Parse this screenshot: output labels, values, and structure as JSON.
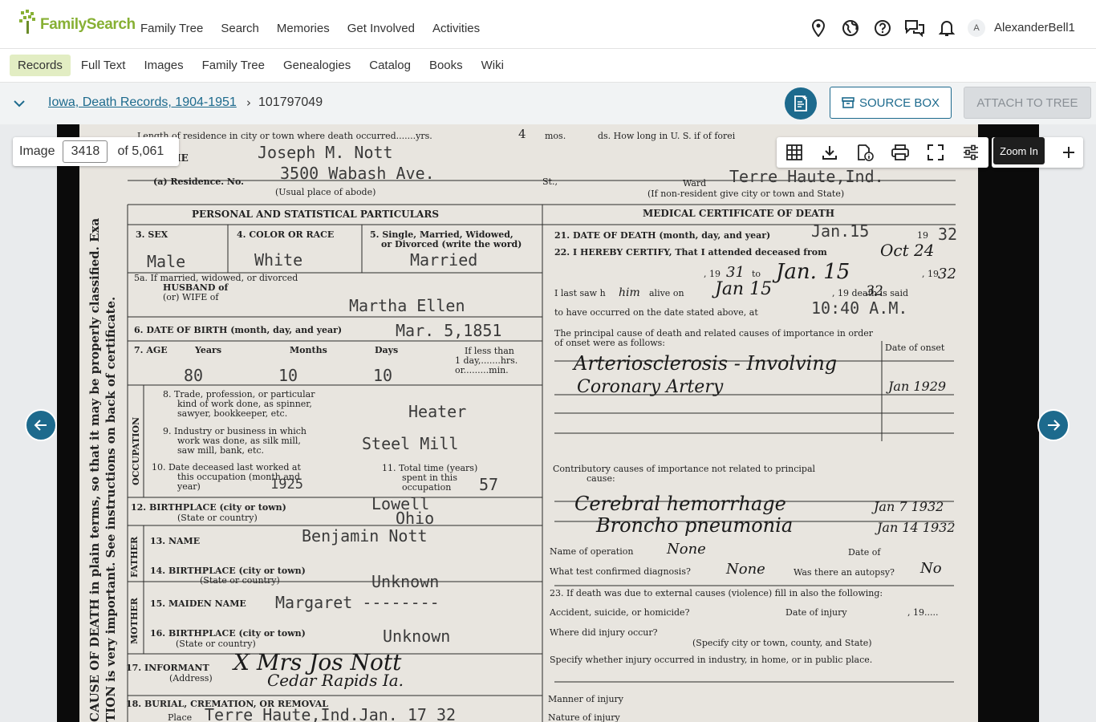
{
  "brand": {
    "logo_text": "FamilySearch",
    "color": "#87b034"
  },
  "main_nav": [
    "Family Tree",
    "Search",
    "Memories",
    "Get Involved",
    "Activities"
  ],
  "top_icons": [
    "location-pin-icon",
    "globe-icon",
    "help-icon",
    "chat-icon",
    "bell-icon"
  ],
  "user": {
    "initial": "A",
    "name": "AlexanderBell1"
  },
  "sub_nav": {
    "items": [
      "Records",
      "Full Text",
      "Images",
      "Family Tree",
      "Genealogies",
      "Catalog",
      "Books",
      "Wiki"
    ],
    "active": "Records"
  },
  "breadcrumb": {
    "collection": "Iowa, Death Records, 1904-1951",
    "separator": "›",
    "record_id": "101797049"
  },
  "actions": {
    "source_box": "SOURCE BOX",
    "attach": "ATTACH TO TREE",
    "accent": "#1d6a8d"
  },
  "viewer": {
    "image_label": "Image",
    "image_number": "3418",
    "image_total": "of 5,061",
    "tooltip": "Zoom In",
    "toolbar_icons": [
      "grid-icon",
      "download-icon",
      "info-document-icon",
      "print-icon",
      "fullscreen-icon",
      "adjust-icon"
    ]
  },
  "document": {
    "typed_values": {
      "full_name": "Joseph M. Nott",
      "residence": "3500 Wabash Ave.",
      "residence_city": "Terre Haute,Ind.",
      "sex": "Male",
      "color": "White",
      "marital": "Married",
      "spouse": "Martha Ellen",
      "birth_date": "Mar. 5,1851",
      "age_years": "80",
      "age_months": "10",
      "age_days": "10",
      "occupation": "Heater",
      "industry": "Steel Mill",
      "last_worked": "1925",
      "years_occupation": "57",
      "birthplace": "Lowell",
      "birthplace_state": "Ohio",
      "father_name": "Benjamin Nott",
      "father_birthplace": "Unknown",
      "mother_maiden": "Margaret --------",
      "mother_birthplace": "Unknown",
      "death_date": "Jan.15",
      "death_year": "32",
      "death_time": "10:40 A.M.",
      "burial": "Terre Haute,Ind.Jan. 17   32"
    },
    "form_text": {
      "residence_line": "Length of residence in city or town where death occurred.......yrs.",
      "residence_yrs": "4",
      "residence_mos": "mos.",
      "residence_ds": "ds.  How long in U. S. if of forei",
      "full_name_label": "LL NAME",
      "residence_label": "(a)  Residence.   No.",
      "street_label": "St.,",
      "ward_label": "Ward",
      "abode_note": "(Usual place of abode)",
      "nonresident_note": "(If non-resident give city or town and State)",
      "personal_header": "PERSONAL AND STATISTICAL PARTICULARS",
      "medical_header": "MEDICAL CERTIFICATE OF DEATH",
      "sex_label": "3. SEX",
      "color_label": "4. COLOR OR RACE",
      "marital_label_1": "5. Single, Married, Widowed,",
      "marital_label_2": "or Divorced (write the word)",
      "spouse_label_1": "5a. If married, widowed, or divorced",
      "spouse_label_2": "HUSBAND of",
      "spouse_label_3": "(or)  WIFE of",
      "birth_label": "6. DATE OF BIRTH (month, day, and year)",
      "age_label": "7. AGE",
      "years_label": "Years",
      "months_label": "Months",
      "days_label": "Days",
      "less_label_1": "If less than",
      "less_label_2": "1 day,.......hrs.",
      "less_label_3": "or.........min.",
      "occupation_side": "OCCUPATION",
      "trade_label_1": "8. Trade, profession, or particular",
      "trade_label_2": "kind of work done, as spinner,",
      "trade_label_3": "sawyer, bookkeeper, etc.",
      "industry_label_1": "9. Industry or business in which",
      "industry_label_2": "work was done, as silk mill,",
      "industry_label_3": "saw mill, bank, etc.",
      "worked_label_1": "10. Date deceased last worked at",
      "worked_label_2": "this occupation (month and",
      "worked_label_3": "year)",
      "total_label_1": "11. Total time (years)",
      "total_label_2": "spent in this",
      "total_label_3": "occupation",
      "birthplace_label_1": "12. BIRTHPLACE (city or town)",
      "birthplace_label_2": "(State or country)",
      "father_side": "FATHER",
      "father_name_label": "13. NAME",
      "father_birth_label_1": "14. BIRTHPLACE (city or town)",
      "father_birth_label_2": "(State or country)",
      "mother_side": "MOTHER",
      "maiden_label": "15. MAIDEN NAME",
      "mother_birth_label_1": "16. BIRTHPLACE (city or town)",
      "mother_birth_label_2": "(State or country)",
      "informant_label_1": "17. INFORMANT",
      "informant_label_2": "(Address)",
      "burial_label": "18. BURIAL, CREMATION, OR REMOVAL",
      "burial_place": "Place",
      "death_date_label": "21. DATE OF DEATH (month, day, and year)",
      "death_year_prefix": "19",
      "certify_label": "22. I HEREBY CERTIFY, That I attended deceased from",
      "certify_from_year": ", 19",
      "certify_to": "to",
      "certify_to_year": ", 19",
      "last_saw_label": "I last saw h",
      "alive_on": "alive on",
      "death_said": ", 19   death is said",
      "occurred_label": "to have occurred on the date stated above, at",
      "principal_label_1": "The principal cause of death and related causes of importance in order",
      "principal_label_2": "of onset were as follows:",
      "onset_label": "Date of onset",
      "contributory_label_1": "Contributory causes of importance not related to principal",
      "contributory_label_2": "cause:",
      "operation_label": "Name of operation",
      "operation_date_label": "Date of",
      "diagnosis_label": "What test confirmed diagnosis?",
      "autopsy_label": "Was there an autopsy?",
      "external_label": "23. If death was due to external causes (violence) fill in also the following:",
      "accident_label": "Accident, suicide, or homicide?",
      "injury_date_label": "Date of injury",
      "injury_year": ", 19.....",
      "where_label": "Where did injury occur?",
      "specify_place": "(Specify city or town, county, and State)",
      "industry_note": "Specify whether injury occurred in industry, in home, or in public place.",
      "manner_label": "Manner of injury",
      "nature_label": "Nature of injury",
      "margin_text_1": "CAUSE OF DEATH in plain terms, so that it may be properly classified.  Exa",
      "margin_text_2": "TION is very important.  See instructions on back of certificate."
    },
    "handwriting": {
      "attended_from": "Oct 24",
      "from_year": "31",
      "to": "Jan. 15",
      "to_year": "32",
      "last_saw_him": "him",
      "last_saw": "Jan 15",
      "death_year_hw": "32",
      "cause_1": "Arteriosclerosis - Involving",
      "cause_2": "Coronary Artery",
      "onset_1": "Jan 1929",
      "contrib_1": "Cerebral hemorrhage",
      "contrib_1_date": "Jan 7 1932",
      "contrib_2": "Broncho pneumonia",
      "contrib_2_date": "Jan 14 1932",
      "operation": "None",
      "diagnosis": "None",
      "autopsy": "No",
      "informant": "X  Mrs Jos Nott",
      "informant_addr": "Cedar Rapids Ia."
    }
  }
}
